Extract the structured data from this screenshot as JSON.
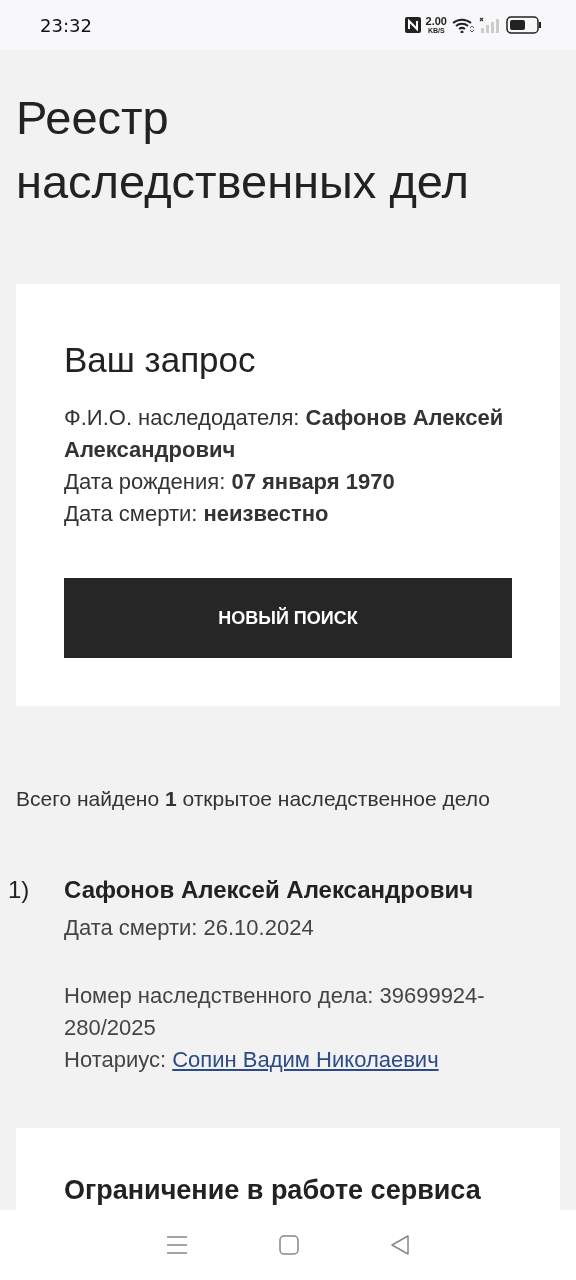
{
  "status_bar": {
    "time": "23:32",
    "speed_value": "2.00",
    "speed_unit": "KB/S",
    "battery": {
      "level": 0.6
    }
  },
  "page_title": "Реестр наследственных дел",
  "query_card": {
    "title": "Ваш запрос",
    "lines": [
      {
        "label": "Ф.И.О. наследодателя:",
        "value": "Сафонов Алексей Александрович"
      },
      {
        "label": "Дата рождения:",
        "value": "07 января 1970"
      },
      {
        "label": "Дата смерти:",
        "value": "неизвестно"
      }
    ],
    "button": "НОВЫЙ ПОИСК"
  },
  "summary": "Всего найдено **1** открытое наследственное дело",
  "results": [
    {
      "index": "1)",
      "name": "Сафонов Алексей Александрович",
      "death_date": "Дата смерти: 26.10.2024",
      "case_number": "Номер наследственного дела: 39699924-280/2025",
      "notary_label": "Нотариус:",
      "notary_link": "Сопин Вадим Николаевич"
    }
  ],
  "notice_card": {
    "title": "Ограничение в работе сервиса"
  }
}
